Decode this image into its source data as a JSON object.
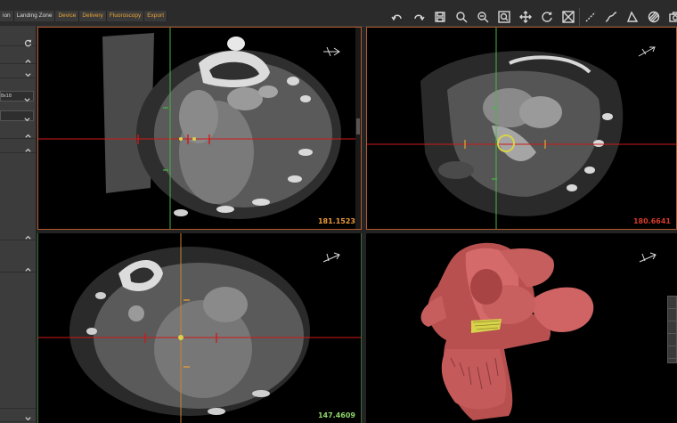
{
  "tabs": [
    {
      "label": "ion",
      "active": false
    },
    {
      "label": "Landing Zone",
      "active": false
    },
    {
      "label": "Device",
      "active": true
    },
    {
      "label": "Delivery",
      "active": false
    },
    {
      "label": "Fluoroscopy",
      "active": false
    },
    {
      "label": "Export",
      "active": false
    }
  ],
  "toolbar_icons": [
    "undo-icon",
    "redo-icon",
    "save-icon",
    "zoom-icon",
    "zoom-out-icon",
    "zoom-fit-icon",
    "pan-icon",
    "rotate-icon",
    "crop-icon",
    "line-measure-icon",
    "curve-measure-icon",
    "angle-measure-icon",
    "window-level-icon",
    "camera-icon"
  ],
  "sidebar": {
    "dropdown_value": "8x18"
  },
  "viewports": {
    "axial": {
      "readout": "181.1523"
    },
    "sagittal": {
      "readout": "180.6641"
    },
    "coronal": {
      "readout": "147.4609"
    },
    "render3d": {
      "readout": ""
    }
  },
  "colors": {
    "accent_orange": "#e9a336",
    "crosshair_red": "#d01818",
    "crosshair_green": "#46b646",
    "tissue_pink": "#d46a6a",
    "device_yellow": "#d8d24a"
  }
}
